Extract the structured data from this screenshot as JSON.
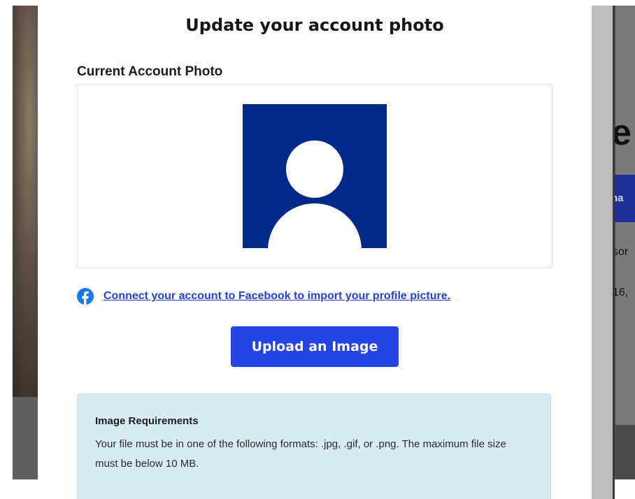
{
  "modal": {
    "title": "Update your account photo",
    "current_photo_label": "Current Account Photo",
    "facebook_link": "Connect your account to Facebook to import your profile picture.",
    "upload_button": "Upload an Image",
    "requirements": {
      "title": "Image Requirements",
      "text": "Your file must be in one of the following formats: .jpg, .gif, or .png. The maximum file size must be below 10 MB."
    }
  },
  "background": {
    "headline_fragment": "e",
    "button_fragment": "na",
    "text_fragment_1": "sor",
    "text_fragment_2": "16,"
  },
  "icons": {
    "avatar": "default-user-avatar",
    "facebook": "facebook-icon"
  },
  "colors": {
    "avatar_bg": "#00298a",
    "primary_button": "#2544e6",
    "link": "#2541d6",
    "facebook_blue": "#1877f2",
    "info_box_bg": "#d8ebf3"
  }
}
